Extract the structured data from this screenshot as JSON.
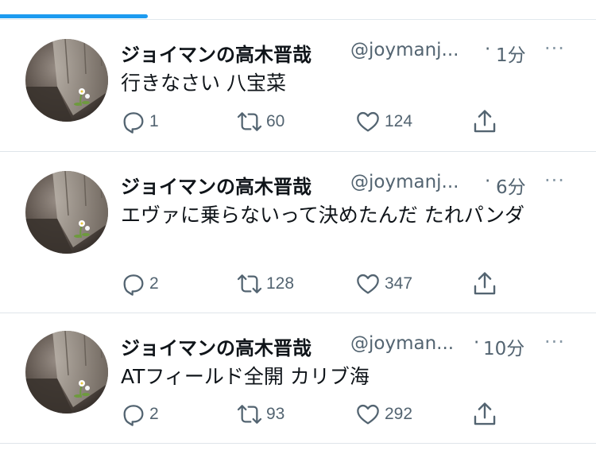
{
  "tabs": {
    "active_index": 0
  },
  "tweets": [
    {
      "name": "ジョイマンの高木晋哉",
      "handle": "@joymanj...",
      "dot": "·",
      "time": "1分",
      "text": "行きなさい  八宝菜",
      "more": "···",
      "reply_count": "1",
      "retweet_count": "60",
      "like_count": "124"
    },
    {
      "name": "ジョイマンの高木晋哉",
      "handle": "@joymanj...",
      "dot": "·",
      "time": "6分",
      "text": "エヴァに乗らないって決めたんだ  たれパンダ",
      "more": "···",
      "reply_count": "2",
      "retweet_count": "128",
      "like_count": "347"
    },
    {
      "name": "ジョイマンの高木晋哉",
      "handle": "@joyman...",
      "dot": "·",
      "time": "10分",
      "text": "ATフィールド全開  カリブ海",
      "more": "···",
      "reply_count": "2",
      "retweet_count": "93",
      "like_count": "292"
    }
  ],
  "icons": {
    "reply": "reply-icon",
    "retweet": "retweet-icon",
    "like": "heart-icon",
    "share": "share-icon",
    "more": "more-icon"
  },
  "colors": {
    "accent": "#1d9bf0",
    "secondary_text": "#536471",
    "primary_text": "#0f1419",
    "divider": "#dfe5ea"
  }
}
